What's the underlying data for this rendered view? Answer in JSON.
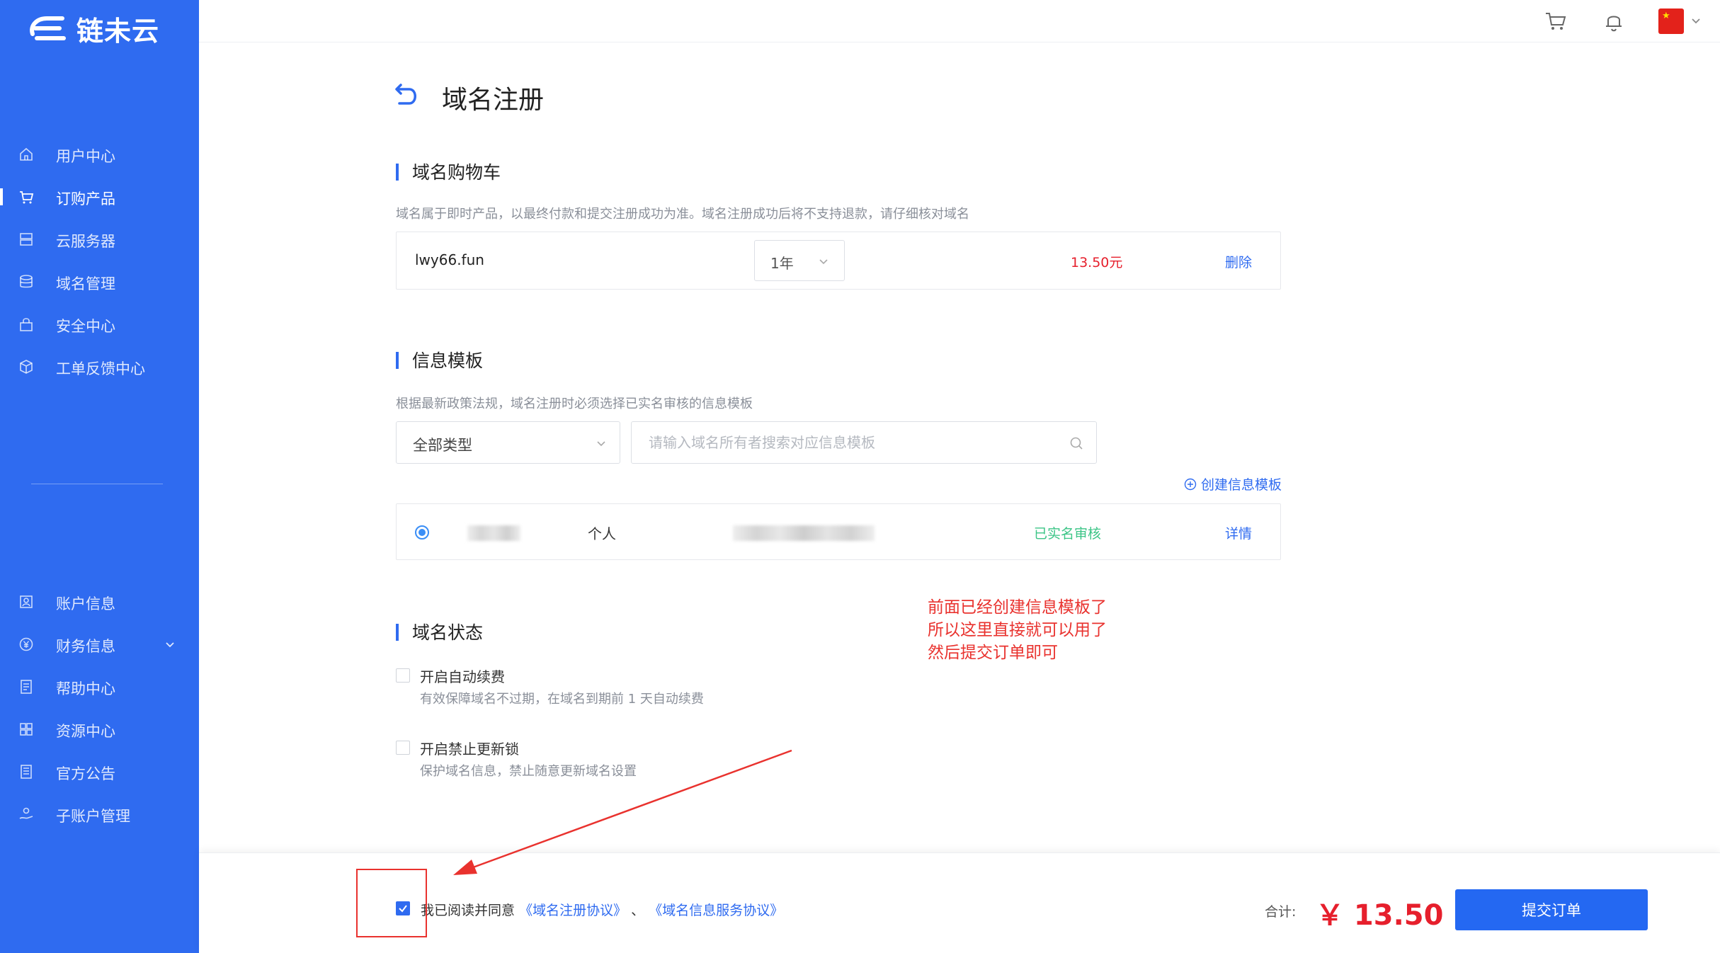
{
  "brand": {
    "name": "链未云"
  },
  "sidebar": {
    "items": [
      {
        "label": "用户中心",
        "icon": "home-icon"
      },
      {
        "label": "订购产品",
        "icon": "cart-icon",
        "active": true
      },
      {
        "label": "云服务器",
        "icon": "server-icon"
      },
      {
        "label": "域名管理",
        "icon": "database-icon"
      },
      {
        "label": "安全中心",
        "icon": "lock-icon"
      },
      {
        "label": "工单反馈中心",
        "icon": "cube-icon"
      }
    ],
    "items2": [
      {
        "label": "账户信息",
        "icon": "id-card-icon"
      },
      {
        "label": "财务信息",
        "icon": "yuan-icon",
        "expandable": true
      },
      {
        "label": "帮助中心",
        "icon": "document-icon"
      },
      {
        "label": "资源中心",
        "icon": "grid-icon"
      },
      {
        "label": "官方公告",
        "icon": "notice-icon"
      },
      {
        "label": "子账户管理",
        "icon": "user-hand-icon"
      }
    ]
  },
  "page": {
    "title": "域名注册"
  },
  "cart": {
    "title": "域名购物车",
    "hint": "域名属于即时产品，以最终付款和提交注册成功为准。域名注册成功后将不支持退款，请仔细核对域名",
    "domain": "lwy66.fun",
    "year": "1年",
    "price": "13.50元",
    "delete_label": "删除"
  },
  "template": {
    "title": "信息模板",
    "hint": "根据最新政策法规，域名注册时必须选择已实名审核的信息模板",
    "type_select": "全部类型",
    "search_placeholder": "请输入域名所有者搜索对应信息模板",
    "create_label": "创建信息模板",
    "row": {
      "type": "个人",
      "status": "已实名审核",
      "detail_label": "详情"
    }
  },
  "status": {
    "title": "域名状态",
    "auto_renew": {
      "title": "开启自动续费",
      "desc": "有效保障域名不过期，在域名到期前 1 天自动续费"
    },
    "update_lock": {
      "title": "开启禁止更新锁",
      "desc": "保护域名信息，禁止随意更新域名设置"
    }
  },
  "annotation": {
    "line1": "前面已经创建信息模板了",
    "line2": "所以这里直接就可以用了",
    "line3": "然后提交订单即可"
  },
  "footer": {
    "agree_prefix": "我已阅读并同意",
    "agree_link1": "《域名注册协议》",
    "agree_sep": "、",
    "agree_link2": "《域名信息服务协议》",
    "total_label": "合计:",
    "total_price": "￥ 13.50",
    "submit_label": "提交订单"
  },
  "colors": {
    "primary": "#2f6bf0",
    "price": "#e61f2c",
    "success": "#3cc587",
    "annotation": "#e9322e"
  }
}
